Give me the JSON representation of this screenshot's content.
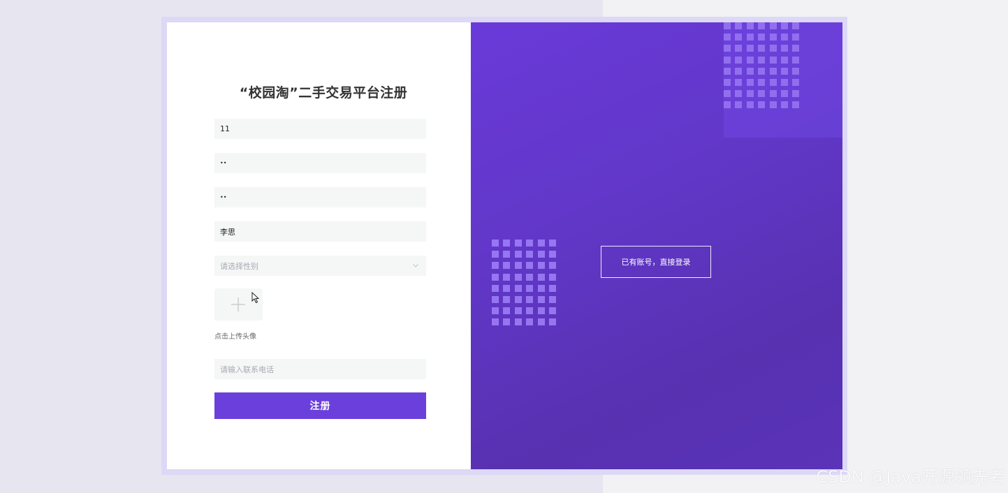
{
  "form": {
    "title": "“校园淘”二手交易平台注册",
    "username_value": "11",
    "password_value": "••",
    "confirm_password_value": "••",
    "name_value": "李思",
    "gender_placeholder": "请选择性别",
    "upload_label": "点击上传头像",
    "phone_placeholder": "请输入联系电话",
    "submit_label": "注册"
  },
  "side": {
    "login_link_label": "已有账号，直接登录"
  },
  "watermark": "CSDN @Java开源领先者",
  "colors": {
    "accent": "#6a3fdc",
    "panel": "#6137c8",
    "field_bg": "#f5f6f6"
  },
  "icons": {
    "upload": "plus-icon",
    "select": "chevron-down-icon",
    "pointer": "mouse-cursor-icon"
  }
}
